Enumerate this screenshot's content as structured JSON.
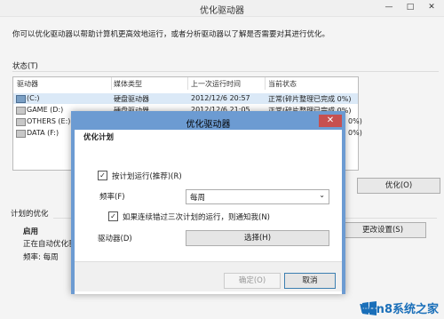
{
  "window": {
    "title": "优化驱动器",
    "minimize": "—",
    "maximize": "□",
    "close": "✕"
  },
  "description": "你可以优化驱动器以帮助计算机更高效地运行，或者分析驱动器以了解是否需要对其进行优化。",
  "status_label": "状态(T)",
  "columns": [
    "驱动器",
    "媒体类型",
    "上一次运行时间",
    "当前状态"
  ],
  "drives": [
    {
      "name": "(C:)",
      "media": "硬盘驱动器",
      "last_run": "2012/12/6 20:57",
      "status": "正常(碎片整理已完成 0%)",
      "selected": true
    },
    {
      "name": "GAME (D:)",
      "media": "硬盘驱动器",
      "last_run": "2012/12/6 21:05",
      "status": "正常(碎片整理已完成 0%)"
    },
    {
      "name": "OTHERS (E:)",
      "media": "",
      "last_run": "",
      "status": "0%)"
    },
    {
      "name": "DATA (F:)",
      "media": "",
      "last_run": "",
      "status": "0%)"
    }
  ],
  "optimize_button": "优化(O)",
  "scheduled": {
    "label": "计划的优化",
    "state": "启用",
    "running": "正在自动优化驱",
    "frequency": "频率: 每周",
    "change_button": "更改设置(S)"
  },
  "dialog": {
    "title": "优化驱动器",
    "close": "✕",
    "heading": "优化计划",
    "run_on_schedule": "按计划运行(推荐)(R)",
    "frequency_label": "频率(F)",
    "frequency_value": "每周",
    "notify_label": "如果连续错过三次计划的运行，则通知我(N)",
    "drives_label": "驱动器(D)",
    "choose_button": "选择(H)",
    "ok_button": "确定(O)",
    "cancel_button": "取消"
  },
  "watermark": "Win8系统之家"
}
